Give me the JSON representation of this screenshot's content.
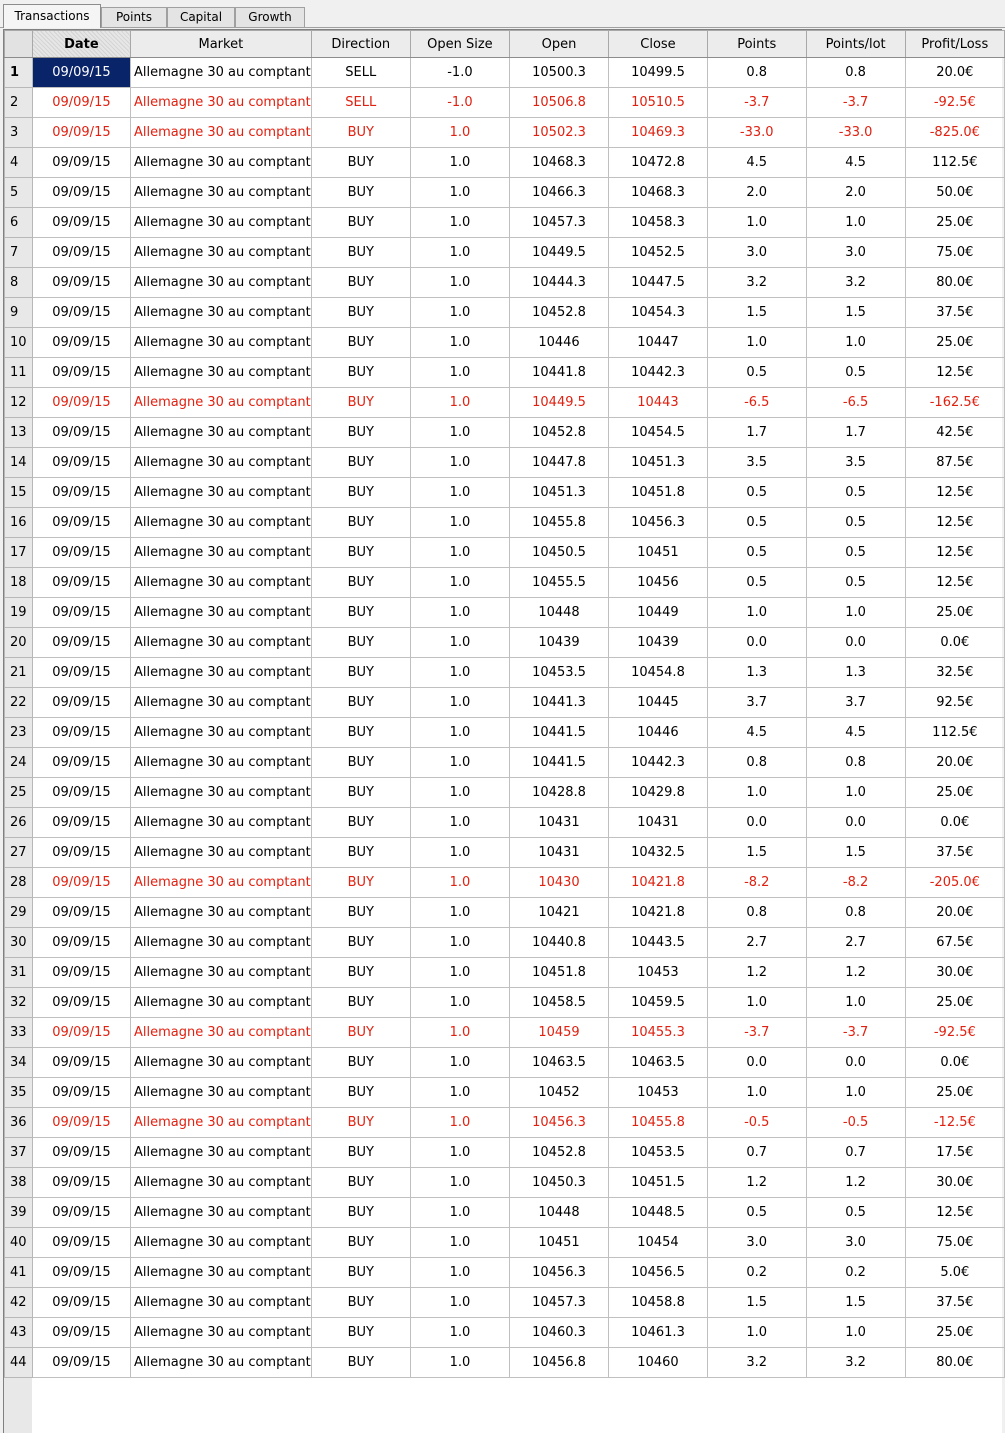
{
  "tabs": [
    {
      "label": "Transactions",
      "active": true
    },
    {
      "label": "Points",
      "active": false
    },
    {
      "label": "Capital",
      "active": false
    },
    {
      "label": "Growth",
      "active": false
    }
  ],
  "columns": [
    "Date",
    "Market",
    "Direction",
    "Open Size",
    "Open",
    "Close",
    "Points",
    "Points/lot",
    "Profit/Loss"
  ],
  "loss_color": "#e02010",
  "selection_color": "#0a246a",
  "rows": [
    {
      "n": "1",
      "date": "09/09/15",
      "market": "Allemagne 30 au comptant",
      "dir": "SELL",
      "size": "-1.0",
      "open": "10500.3",
      "close": "10499.5",
      "pts": "0.8",
      "ptslot": "0.8",
      "pl": "20.0€",
      "loss": false
    },
    {
      "n": "2",
      "date": "09/09/15",
      "market": "Allemagne 30 au comptant",
      "dir": "SELL",
      "size": "-1.0",
      "open": "10506.8",
      "close": "10510.5",
      "pts": "-3.7",
      "ptslot": "-3.7",
      "pl": "-92.5€",
      "loss": true
    },
    {
      "n": "3",
      "date": "09/09/15",
      "market": "Allemagne 30 au comptant",
      "dir": "BUY",
      "size": "1.0",
      "open": "10502.3",
      "close": "10469.3",
      "pts": "-33.0",
      "ptslot": "-33.0",
      "pl": "-825.0€",
      "loss": true
    },
    {
      "n": "4",
      "date": "09/09/15",
      "market": "Allemagne 30 au comptant",
      "dir": "BUY",
      "size": "1.0",
      "open": "10468.3",
      "close": "10472.8",
      "pts": "4.5",
      "ptslot": "4.5",
      "pl": "112.5€",
      "loss": false
    },
    {
      "n": "5",
      "date": "09/09/15",
      "market": "Allemagne 30 au comptant",
      "dir": "BUY",
      "size": "1.0",
      "open": "10466.3",
      "close": "10468.3",
      "pts": "2.0",
      "ptslot": "2.0",
      "pl": "50.0€",
      "loss": false
    },
    {
      "n": "6",
      "date": "09/09/15",
      "market": "Allemagne 30 au comptant",
      "dir": "BUY",
      "size": "1.0",
      "open": "10457.3",
      "close": "10458.3",
      "pts": "1.0",
      "ptslot": "1.0",
      "pl": "25.0€",
      "loss": false
    },
    {
      "n": "7",
      "date": "09/09/15",
      "market": "Allemagne 30 au comptant",
      "dir": "BUY",
      "size": "1.0",
      "open": "10449.5",
      "close": "10452.5",
      "pts": "3.0",
      "ptslot": "3.0",
      "pl": "75.0€",
      "loss": false
    },
    {
      "n": "8",
      "date": "09/09/15",
      "market": "Allemagne 30 au comptant",
      "dir": "BUY",
      "size": "1.0",
      "open": "10444.3",
      "close": "10447.5",
      "pts": "3.2",
      "ptslot": "3.2",
      "pl": "80.0€",
      "loss": false
    },
    {
      "n": "9",
      "date": "09/09/15",
      "market": "Allemagne 30 au comptant",
      "dir": "BUY",
      "size": "1.0",
      "open": "10452.8",
      "close": "10454.3",
      "pts": "1.5",
      "ptslot": "1.5",
      "pl": "37.5€",
      "loss": false
    },
    {
      "n": "10",
      "date": "09/09/15",
      "market": "Allemagne 30 au comptant",
      "dir": "BUY",
      "size": "1.0",
      "open": "10446",
      "close": "10447",
      "pts": "1.0",
      "ptslot": "1.0",
      "pl": "25.0€",
      "loss": false
    },
    {
      "n": "11",
      "date": "09/09/15",
      "market": "Allemagne 30 au comptant",
      "dir": "BUY",
      "size": "1.0",
      "open": "10441.8",
      "close": "10442.3",
      "pts": "0.5",
      "ptslot": "0.5",
      "pl": "12.5€",
      "loss": false
    },
    {
      "n": "12",
      "date": "09/09/15",
      "market": "Allemagne 30 au comptant",
      "dir": "BUY",
      "size": "1.0",
      "open": "10449.5",
      "close": "10443",
      "pts": "-6.5",
      "ptslot": "-6.5",
      "pl": "-162.5€",
      "loss": true
    },
    {
      "n": "13",
      "date": "09/09/15",
      "market": "Allemagne 30 au comptant",
      "dir": "BUY",
      "size": "1.0",
      "open": "10452.8",
      "close": "10454.5",
      "pts": "1.7",
      "ptslot": "1.7",
      "pl": "42.5€",
      "loss": false
    },
    {
      "n": "14",
      "date": "09/09/15",
      "market": "Allemagne 30 au comptant",
      "dir": "BUY",
      "size": "1.0",
      "open": "10447.8",
      "close": "10451.3",
      "pts": "3.5",
      "ptslot": "3.5",
      "pl": "87.5€",
      "loss": false
    },
    {
      "n": "15",
      "date": "09/09/15",
      "market": "Allemagne 30 au comptant",
      "dir": "BUY",
      "size": "1.0",
      "open": "10451.3",
      "close": "10451.8",
      "pts": "0.5",
      "ptslot": "0.5",
      "pl": "12.5€",
      "loss": false
    },
    {
      "n": "16",
      "date": "09/09/15",
      "market": "Allemagne 30 au comptant",
      "dir": "BUY",
      "size": "1.0",
      "open": "10455.8",
      "close": "10456.3",
      "pts": "0.5",
      "ptslot": "0.5",
      "pl": "12.5€",
      "loss": false
    },
    {
      "n": "17",
      "date": "09/09/15",
      "market": "Allemagne 30 au comptant",
      "dir": "BUY",
      "size": "1.0",
      "open": "10450.5",
      "close": "10451",
      "pts": "0.5",
      "ptslot": "0.5",
      "pl": "12.5€",
      "loss": false
    },
    {
      "n": "18",
      "date": "09/09/15",
      "market": "Allemagne 30 au comptant",
      "dir": "BUY",
      "size": "1.0",
      "open": "10455.5",
      "close": "10456",
      "pts": "0.5",
      "ptslot": "0.5",
      "pl": "12.5€",
      "loss": false
    },
    {
      "n": "19",
      "date": "09/09/15",
      "market": "Allemagne 30 au comptant",
      "dir": "BUY",
      "size": "1.0",
      "open": "10448",
      "close": "10449",
      "pts": "1.0",
      "ptslot": "1.0",
      "pl": "25.0€",
      "loss": false
    },
    {
      "n": "20",
      "date": "09/09/15",
      "market": "Allemagne 30 au comptant",
      "dir": "BUY",
      "size": "1.0",
      "open": "10439",
      "close": "10439",
      "pts": "0.0",
      "ptslot": "0.0",
      "pl": "0.0€",
      "loss": false
    },
    {
      "n": "21",
      "date": "09/09/15",
      "market": "Allemagne 30 au comptant",
      "dir": "BUY",
      "size": "1.0",
      "open": "10453.5",
      "close": "10454.8",
      "pts": "1.3",
      "ptslot": "1.3",
      "pl": "32.5€",
      "loss": false
    },
    {
      "n": "22",
      "date": "09/09/15",
      "market": "Allemagne 30 au comptant",
      "dir": "BUY",
      "size": "1.0",
      "open": "10441.3",
      "close": "10445",
      "pts": "3.7",
      "ptslot": "3.7",
      "pl": "92.5€",
      "loss": false
    },
    {
      "n": "23",
      "date": "09/09/15",
      "market": "Allemagne 30 au comptant",
      "dir": "BUY",
      "size": "1.0",
      "open": "10441.5",
      "close": "10446",
      "pts": "4.5",
      "ptslot": "4.5",
      "pl": "112.5€",
      "loss": false
    },
    {
      "n": "24",
      "date": "09/09/15",
      "market": "Allemagne 30 au comptant",
      "dir": "BUY",
      "size": "1.0",
      "open": "10441.5",
      "close": "10442.3",
      "pts": "0.8",
      "ptslot": "0.8",
      "pl": "20.0€",
      "loss": false
    },
    {
      "n": "25",
      "date": "09/09/15",
      "market": "Allemagne 30 au comptant",
      "dir": "BUY",
      "size": "1.0",
      "open": "10428.8",
      "close": "10429.8",
      "pts": "1.0",
      "ptslot": "1.0",
      "pl": "25.0€",
      "loss": false
    },
    {
      "n": "26",
      "date": "09/09/15",
      "market": "Allemagne 30 au comptant",
      "dir": "BUY",
      "size": "1.0",
      "open": "10431",
      "close": "10431",
      "pts": "0.0",
      "ptslot": "0.0",
      "pl": "0.0€",
      "loss": false
    },
    {
      "n": "27",
      "date": "09/09/15",
      "market": "Allemagne 30 au comptant",
      "dir": "BUY",
      "size": "1.0",
      "open": "10431",
      "close": "10432.5",
      "pts": "1.5",
      "ptslot": "1.5",
      "pl": "37.5€",
      "loss": false
    },
    {
      "n": "28",
      "date": "09/09/15",
      "market": "Allemagne 30 au comptant",
      "dir": "BUY",
      "size": "1.0",
      "open": "10430",
      "close": "10421.8",
      "pts": "-8.2",
      "ptslot": "-8.2",
      "pl": "-205.0€",
      "loss": true
    },
    {
      "n": "29",
      "date": "09/09/15",
      "market": "Allemagne 30 au comptant",
      "dir": "BUY",
      "size": "1.0",
      "open": "10421",
      "close": "10421.8",
      "pts": "0.8",
      "ptslot": "0.8",
      "pl": "20.0€",
      "loss": false
    },
    {
      "n": "30",
      "date": "09/09/15",
      "market": "Allemagne 30 au comptant",
      "dir": "BUY",
      "size": "1.0",
      "open": "10440.8",
      "close": "10443.5",
      "pts": "2.7",
      "ptslot": "2.7",
      "pl": "67.5€",
      "loss": false
    },
    {
      "n": "31",
      "date": "09/09/15",
      "market": "Allemagne 30 au comptant",
      "dir": "BUY",
      "size": "1.0",
      "open": "10451.8",
      "close": "10453",
      "pts": "1.2",
      "ptslot": "1.2",
      "pl": "30.0€",
      "loss": false
    },
    {
      "n": "32",
      "date": "09/09/15",
      "market": "Allemagne 30 au comptant",
      "dir": "BUY",
      "size": "1.0",
      "open": "10458.5",
      "close": "10459.5",
      "pts": "1.0",
      "ptslot": "1.0",
      "pl": "25.0€",
      "loss": false
    },
    {
      "n": "33",
      "date": "09/09/15",
      "market": "Allemagne 30 au comptant",
      "dir": "BUY",
      "size": "1.0",
      "open": "10459",
      "close": "10455.3",
      "pts": "-3.7",
      "ptslot": "-3.7",
      "pl": "-92.5€",
      "loss": true
    },
    {
      "n": "34",
      "date": "09/09/15",
      "market": "Allemagne 30 au comptant",
      "dir": "BUY",
      "size": "1.0",
      "open": "10463.5",
      "close": "10463.5",
      "pts": "0.0",
      "ptslot": "0.0",
      "pl": "0.0€",
      "loss": false
    },
    {
      "n": "35",
      "date": "09/09/15",
      "market": "Allemagne 30 au comptant",
      "dir": "BUY",
      "size": "1.0",
      "open": "10452",
      "close": "10453",
      "pts": "1.0",
      "ptslot": "1.0",
      "pl": "25.0€",
      "loss": false
    },
    {
      "n": "36",
      "date": "09/09/15",
      "market": "Allemagne 30 au comptant",
      "dir": "BUY",
      "size": "1.0",
      "open": "10456.3",
      "close": "10455.8",
      "pts": "-0.5",
      "ptslot": "-0.5",
      "pl": "-12.5€",
      "loss": true
    },
    {
      "n": "37",
      "date": "09/09/15",
      "market": "Allemagne 30 au comptant",
      "dir": "BUY",
      "size": "1.0",
      "open": "10452.8",
      "close": "10453.5",
      "pts": "0.7",
      "ptslot": "0.7",
      "pl": "17.5€",
      "loss": false
    },
    {
      "n": "38",
      "date": "09/09/15",
      "market": "Allemagne 30 au comptant",
      "dir": "BUY",
      "size": "1.0",
      "open": "10450.3",
      "close": "10451.5",
      "pts": "1.2",
      "ptslot": "1.2",
      "pl": "30.0€",
      "loss": false
    },
    {
      "n": "39",
      "date": "09/09/15",
      "market": "Allemagne 30 au comptant",
      "dir": "BUY",
      "size": "1.0",
      "open": "10448",
      "close": "10448.5",
      "pts": "0.5",
      "ptslot": "0.5",
      "pl": "12.5€",
      "loss": false
    },
    {
      "n": "40",
      "date": "09/09/15",
      "market": "Allemagne 30 au comptant",
      "dir": "BUY",
      "size": "1.0",
      "open": "10451",
      "close": "10454",
      "pts": "3.0",
      "ptslot": "3.0",
      "pl": "75.0€",
      "loss": false
    },
    {
      "n": "41",
      "date": "09/09/15",
      "market": "Allemagne 30 au comptant",
      "dir": "BUY",
      "size": "1.0",
      "open": "10456.3",
      "close": "10456.5",
      "pts": "0.2",
      "ptslot": "0.2",
      "pl": "5.0€",
      "loss": false
    },
    {
      "n": "42",
      "date": "09/09/15",
      "market": "Allemagne 30 au comptant",
      "dir": "BUY",
      "size": "1.0",
      "open": "10457.3",
      "close": "10458.8",
      "pts": "1.5",
      "ptslot": "1.5",
      "pl": "37.5€",
      "loss": false
    },
    {
      "n": "43",
      "date": "09/09/15",
      "market": "Allemagne 30 au comptant",
      "dir": "BUY",
      "size": "1.0",
      "open": "10460.3",
      "close": "10461.3",
      "pts": "1.0",
      "ptslot": "1.0",
      "pl": "25.0€",
      "loss": false
    },
    {
      "n": "44",
      "date": "09/09/15",
      "market": "Allemagne 30 au comptant",
      "dir": "BUY",
      "size": "1.0",
      "open": "10456.8",
      "close": "10460",
      "pts": "3.2",
      "ptslot": "3.2",
      "pl": "80.0€",
      "loss": false
    }
  ]
}
